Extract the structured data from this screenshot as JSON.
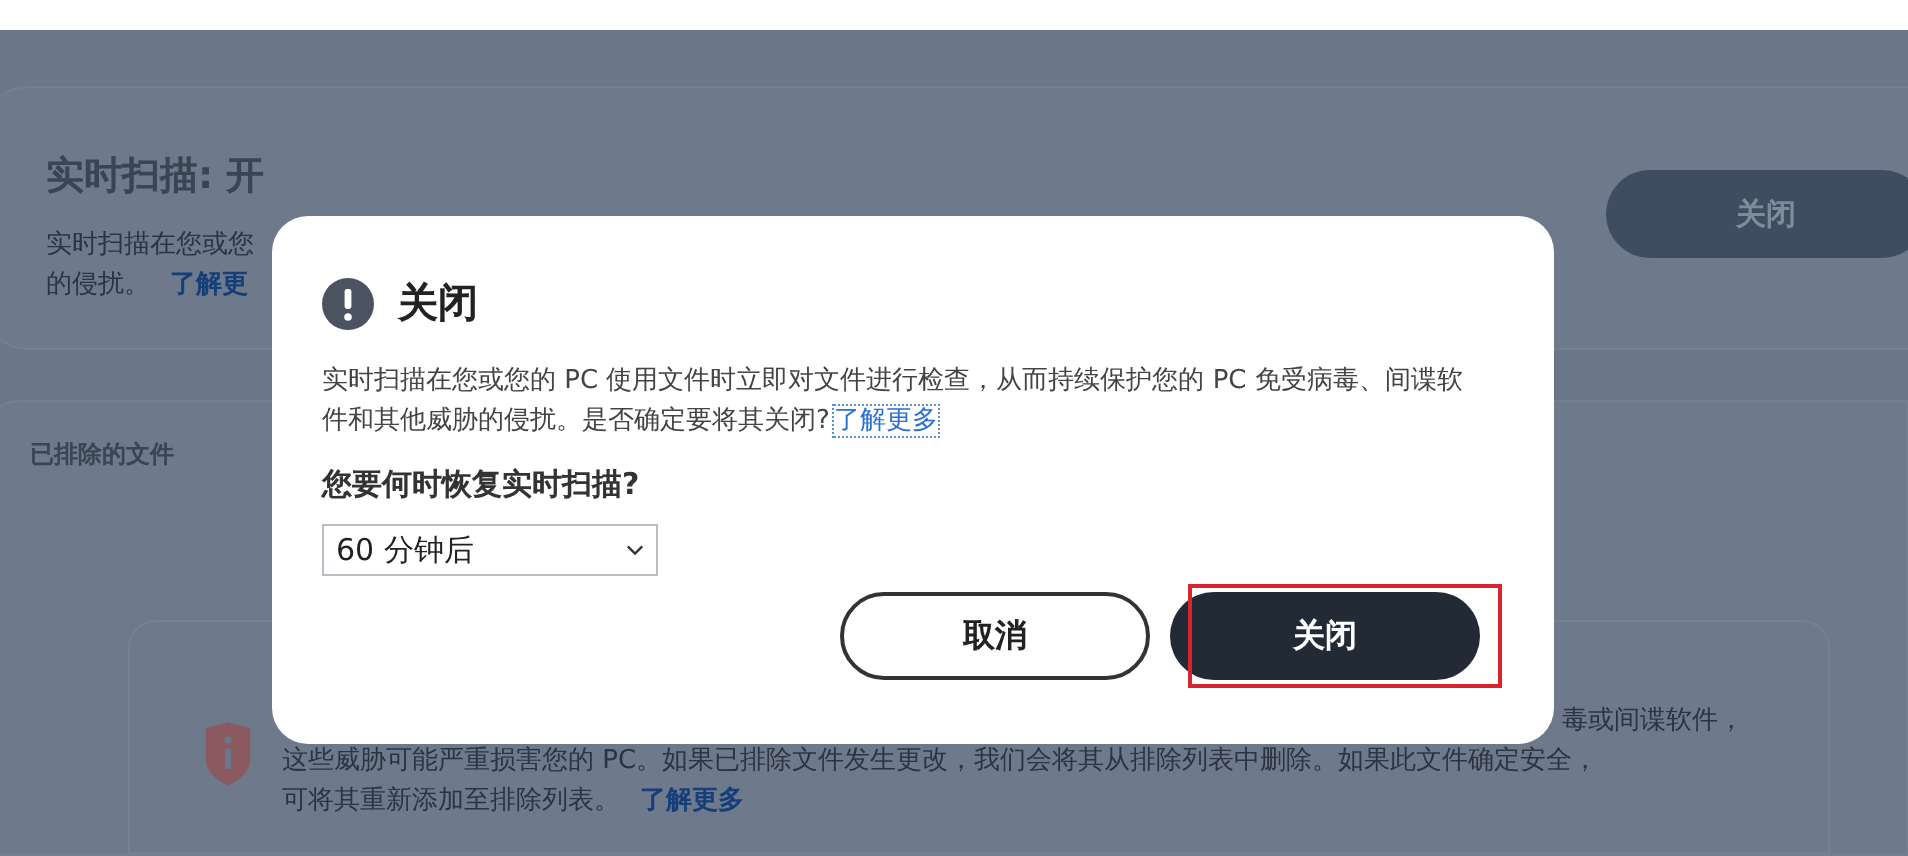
{
  "background": {
    "realtime_card": {
      "title": "实时扫描: 开",
      "description_lines": [
        "实时扫描在您或您",
        "的侵扰。"
      ],
      "link": "了解更",
      "button": "关闭"
    },
    "excluded_card": {
      "title": "已排除的文件",
      "notice_lines": [
        "毒或间谍软件，",
        "这些威胁可能严重损害您的 PC。如果已排除文件发生更改，我们会将其从排除列表中删除。如果此文件确定安全，",
        "可将其重新添加至排除列表。"
      ],
      "link": "了解更多"
    }
  },
  "dialog": {
    "title": "关闭",
    "message": "实时扫描在您或您的 PC 使用文件时立即对文件进行检查，从而持续保护您的 PC 免受病毒、间谍软件和其他威胁的侵扰。是否确定要将其关闭?",
    "link": {
      "label": "了解更多",
      "focused": true
    },
    "question": "您要何时恢复实时扫描?",
    "select": {
      "value": "60 分钟后"
    },
    "buttons": [
      {
        "kind": "secondary",
        "label": "取消",
        "highlighted": false
      },
      {
        "kind": "primary",
        "label": "关闭",
        "highlighted": true
      }
    ]
  }
}
